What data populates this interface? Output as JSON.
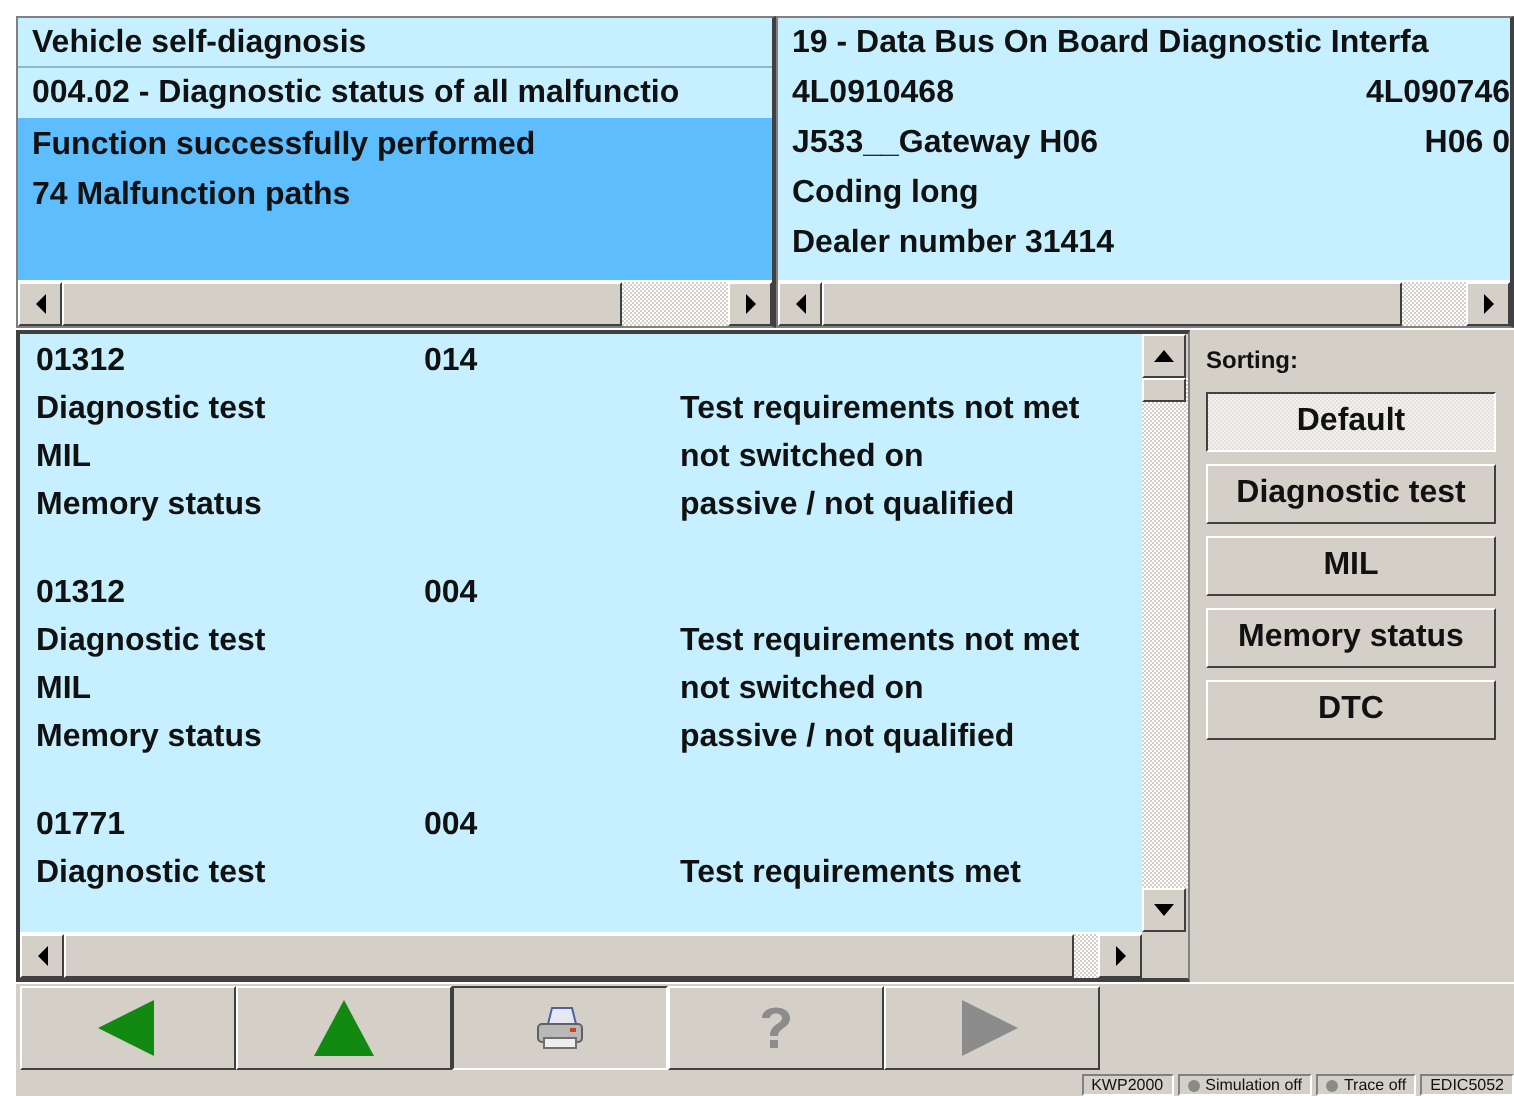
{
  "header_left": {
    "title": "Vehicle self-diagnosis",
    "function": "004.02 - Diagnostic status of all malfunctio",
    "status_lines": [
      "Function successfully performed",
      "74 Malfunction paths"
    ]
  },
  "header_right": {
    "rows": [
      {
        "left": "19 - Data Bus On Board Diagnostic Interfa"
      },
      {
        "left": "4L0910468",
        "right": "4L090746"
      },
      {
        "left": "J533__Gateway   H06",
        "right": "H06  0"
      },
      {
        "left": "Coding long"
      },
      {
        "left": "Dealer number 31414"
      }
    ]
  },
  "malfunctions": [
    {
      "code": "01312",
      "status_code": "014",
      "lines": [
        {
          "label": "Diagnostic test",
          "value": "Test requirements not met"
        },
        {
          "label": "MIL",
          "value": "not switched on"
        },
        {
          "label": "Memory status",
          "value": "passive / not qualified"
        }
      ]
    },
    {
      "code": "01312",
      "status_code": "004",
      "lines": [
        {
          "label": "Diagnostic test",
          "value": "Test requirements not met"
        },
        {
          "label": "MIL",
          "value": "not switched on"
        },
        {
          "label": "Memory status",
          "value": "passive / not qualified"
        }
      ]
    },
    {
      "code": "01771",
      "status_code": "004",
      "lines": [
        {
          "label": "Diagnostic test",
          "value": "Test requirements met"
        }
      ]
    }
  ],
  "sorting": {
    "label": "Sorting:",
    "options": [
      {
        "label": "Default",
        "selected": true
      },
      {
        "label": "Diagnostic test",
        "selected": false
      },
      {
        "label": "MIL",
        "selected": false
      },
      {
        "label": "Memory status",
        "selected": false
      },
      {
        "label": "DTC",
        "selected": false
      }
    ]
  },
  "toolbar": [
    {
      "kind": "back",
      "disabled": false,
      "pressed": false
    },
    {
      "kind": "up",
      "disabled": false,
      "pressed": false
    },
    {
      "kind": "print",
      "disabled": false,
      "pressed": true
    },
    {
      "kind": "help",
      "disabled": true,
      "pressed": false
    },
    {
      "kind": "forward",
      "disabled": true,
      "pressed": false
    }
  ],
  "status_bar": [
    {
      "kind": "text",
      "label": "KWP2000"
    },
    {
      "kind": "indicator",
      "label": "Simulation off"
    },
    {
      "kind": "indicator",
      "label": "Trace off"
    },
    {
      "kind": "text",
      "label": "EDIC5052"
    }
  ]
}
